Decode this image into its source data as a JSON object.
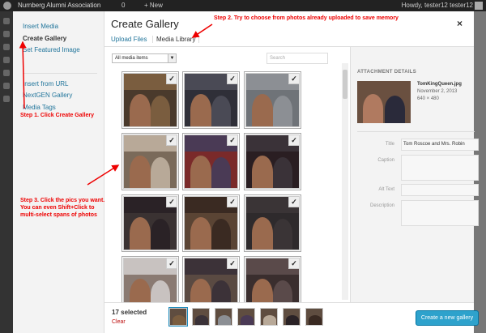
{
  "adminbar": {
    "site_name": "Nurnberg Alumni Association",
    "comment_count": "0",
    "new_label": "New",
    "howdy": "Howdy, tester12 tester12"
  },
  "menu": {
    "items": [
      "Insert Media",
      "Create Gallery",
      "Set Featured Image",
      "Insert from URL",
      "NextGEN Gallery",
      "Media Tags"
    ]
  },
  "modal": {
    "title": "Create Gallery",
    "close": "×",
    "tabs": [
      "Upload Files",
      "Media Library"
    ]
  },
  "toolbar": {
    "filter_value": "All media items",
    "search_placeholder": "Search"
  },
  "grid": {
    "colors": [
      [
        "#7a5d3f",
        "#4a3a2c"
      ],
      [
        "#4a4a55",
        "#2f2f38"
      ],
      [
        "#8c8f94",
        "#6f7378"
      ],
      [
        "#b8a998",
        "#7a6a5a"
      ],
      [
        "#4a3a55",
        "#7a2a2a"
      ],
      [
        "#3a3238",
        "#2a1e22"
      ],
      [
        "#2a2226",
        "#3a3232"
      ],
      [
        "#3a2a22",
        "#5a4434"
      ],
      [
        "#3a3436",
        "#2e2a2c"
      ],
      [
        "#c8c2c0",
        "#8a7a72"
      ],
      [
        "#3c3238",
        "#5a4a42"
      ],
      [
        "#5a4a4a",
        "#3a2e2e"
      ]
    ]
  },
  "attachment": {
    "heading": "ATTACHMENT DETAILS",
    "filename": "TomKingQueen.jpg",
    "date": "November 2, 2013",
    "dimensions": "640 × 480",
    "title_label": "Title",
    "title_value": "Tom Roscoe and Mrs. Robin",
    "caption_label": "Caption",
    "alt_label": "Alt Text",
    "description_label": "Description"
  },
  "footer": {
    "selected": "17 selected",
    "clear": "Clear",
    "button": "Create a new gallery"
  },
  "annotations": {
    "step1": "Step 1. Click Create Gallery",
    "step2": "Step 2. Try to choose from photos already uploaded to save memory",
    "step3": "Step 3.  Click the pics you want.  You can even Shift+Click to multi-select spans of photos"
  }
}
